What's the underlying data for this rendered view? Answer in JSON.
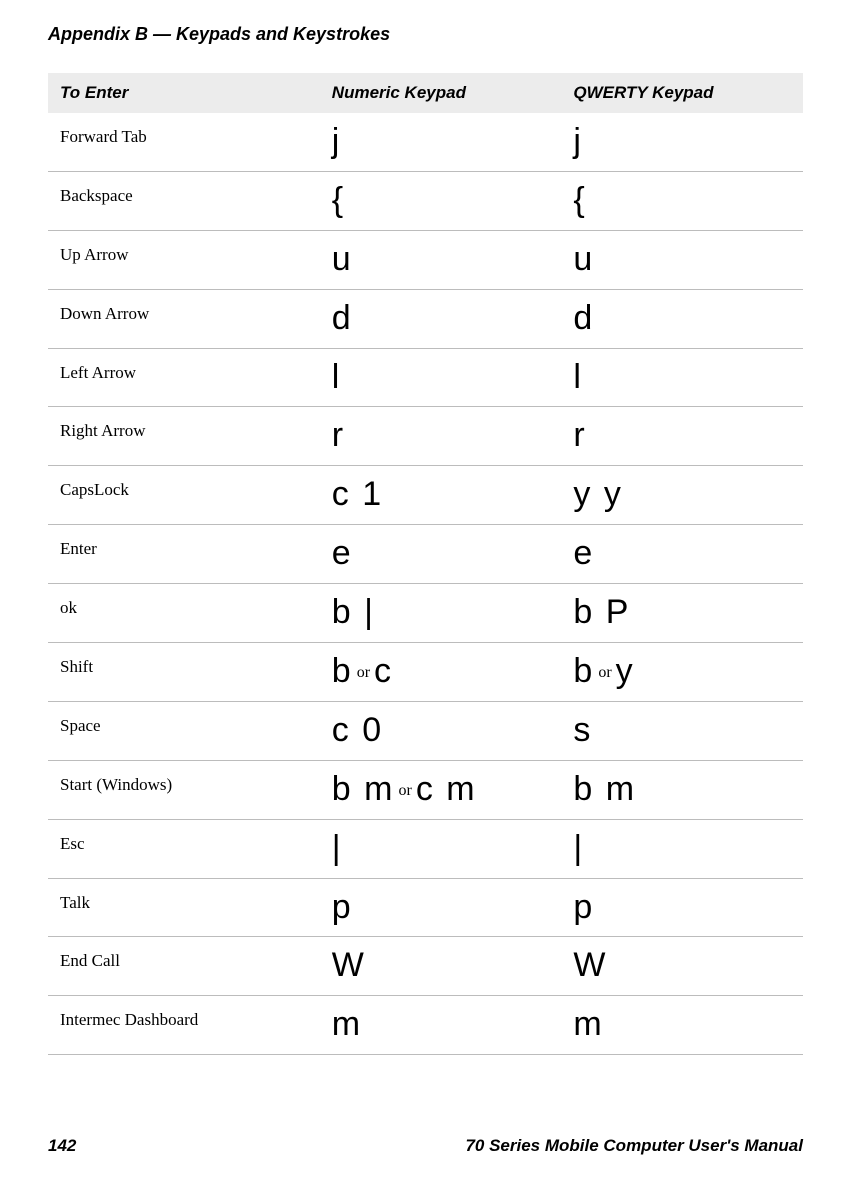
{
  "appendix_title": "Appendix B — Keypads and Keystrokes",
  "headers": {
    "to_enter": "To Enter",
    "numeric": "Numeric Keypad",
    "qwerty": "QWERTY Keypad"
  },
  "or_label": "or",
  "rows": [
    {
      "label": "Forward Tab",
      "numeric": [
        [
          "j"
        ]
      ],
      "qwerty": [
        [
          "j"
        ]
      ]
    },
    {
      "label": "Backspace",
      "numeric": [
        [
          "{"
        ]
      ],
      "qwerty": [
        [
          "{"
        ]
      ]
    },
    {
      "label": "Up Arrow",
      "numeric": [
        [
          "u"
        ]
      ],
      "qwerty": [
        [
          "u"
        ]
      ]
    },
    {
      "label": "Down Arrow",
      "numeric": [
        [
          "d"
        ]
      ],
      "qwerty": [
        [
          "d"
        ]
      ]
    },
    {
      "label": "Left Arrow",
      "numeric": [
        [
          "l"
        ]
      ],
      "qwerty": [
        [
          "l"
        ]
      ]
    },
    {
      "label": "Right Arrow",
      "numeric": [
        [
          "r"
        ]
      ],
      "qwerty": [
        [
          "r"
        ]
      ]
    },
    {
      "label": "CapsLock",
      "numeric": [
        [
          "c",
          "1"
        ]
      ],
      "qwerty": [
        [
          "y",
          "y"
        ]
      ]
    },
    {
      "label": "Enter",
      "numeric": [
        [
          "e"
        ]
      ],
      "qwerty": [
        [
          "e"
        ]
      ]
    },
    {
      "label": "ok",
      "numeric": [
        [
          "b",
          "|"
        ]
      ],
      "qwerty": [
        [
          "b",
          "P"
        ]
      ]
    },
    {
      "label": "Shift",
      "numeric": [
        [
          "b"
        ],
        [
          "c"
        ]
      ],
      "qwerty": [
        [
          "b"
        ],
        [
          "y"
        ]
      ]
    },
    {
      "label": "Space",
      "numeric": [
        [
          "c",
          "0"
        ]
      ],
      "qwerty": [
        [
          "s"
        ]
      ]
    },
    {
      "label": "Start (Windows)",
      "numeric": [
        [
          "b",
          "m"
        ],
        [
          "c",
          "m"
        ]
      ],
      "qwerty": [
        [
          "b",
          "m"
        ]
      ]
    },
    {
      "label": "Esc",
      "numeric": [
        [
          "|"
        ]
      ],
      "qwerty": [
        [
          "|"
        ]
      ]
    },
    {
      "label": "Talk",
      "numeric": [
        [
          "p"
        ]
      ],
      "qwerty": [
        [
          "p"
        ]
      ]
    },
    {
      "label": "End Call",
      "numeric": [
        [
          "W"
        ]
      ],
      "qwerty": [
        [
          "W"
        ]
      ]
    },
    {
      "label": "Intermec Dashboard",
      "numeric": [
        [
          "m"
        ]
      ],
      "qwerty": [
        [
          "m"
        ]
      ]
    }
  ],
  "footer": {
    "page_number": "142",
    "manual_title": "70 Series Mobile Computer User's Manual"
  }
}
